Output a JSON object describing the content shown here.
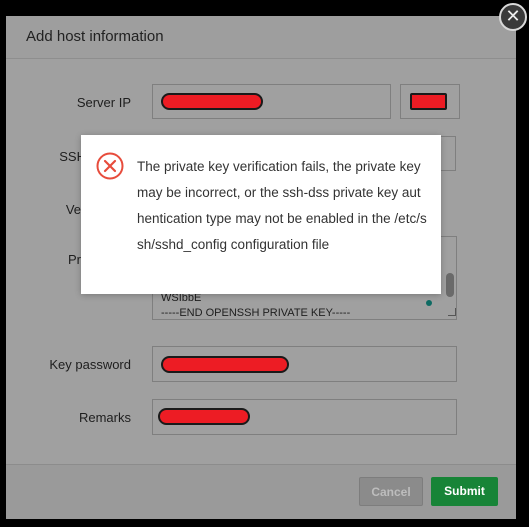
{
  "dialog": {
    "title": "Add host information",
    "close_glyph": "✕"
  },
  "form": {
    "server_ip_label": "Server IP",
    "ssh_label": "SSH",
    "verify_label": "Ve",
    "private_key_label": "Pr",
    "key_password_label": "Key password",
    "remarks_label": "Remarks",
    "private_key_tail": "WSIbbE",
    "private_key_end": "-----END OPENSSH PRIVATE KEY-----"
  },
  "footer": {
    "cancel_label": "Cancel",
    "submit_label": "Submit"
  },
  "error": {
    "icon": "error-circle-x-icon",
    "message": "The private key verification fails, the private key may be incorrect, or the ssh-dss private key authentication type may not be enabled in the /etc/ssh/sshd_config configuration file"
  },
  "colors": {
    "submit_bg": "#178437",
    "error_red": "#e74c3c",
    "redaction": "#ed1c24"
  }
}
